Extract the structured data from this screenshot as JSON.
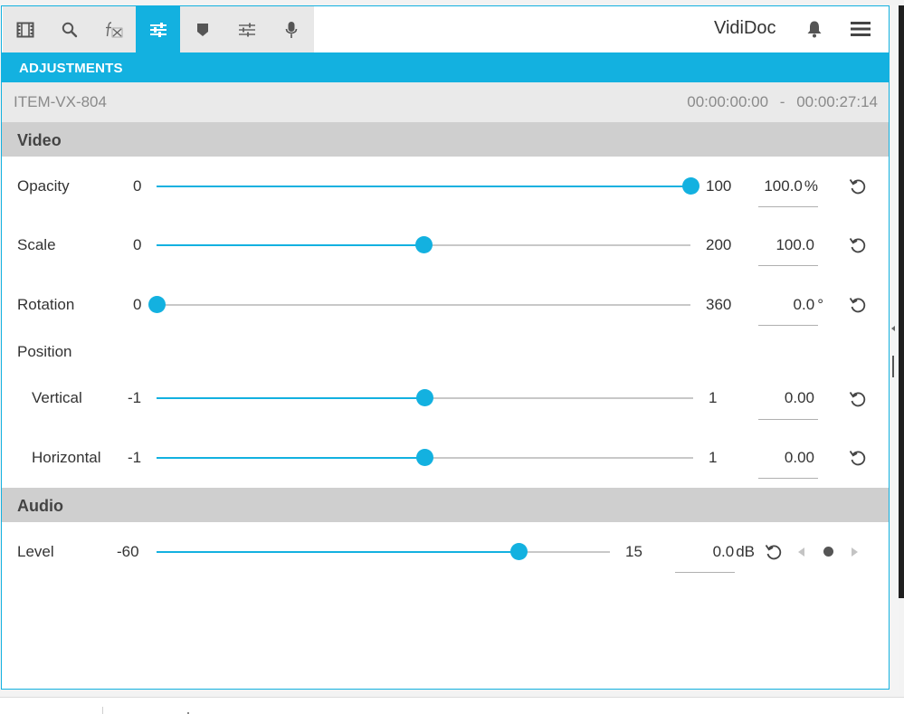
{
  "toolbar": {
    "tools": [
      {
        "icon": "film-strip-icon",
        "active": false
      },
      {
        "icon": "search-icon",
        "active": false
      },
      {
        "icon": "fx-icon",
        "active": false
      },
      {
        "icon": "sliders-icon",
        "active": true
      },
      {
        "icon": "marker-icon",
        "active": false
      },
      {
        "icon": "mixer-icon",
        "active": false
      },
      {
        "icon": "microphone-icon",
        "active": false
      }
    ],
    "brand": "VidiDoc",
    "bell_icon": "bell-icon",
    "menu_icon": "hamburger-menu-icon"
  },
  "panel": {
    "title": "ADJUSTMENTS",
    "item_id": "ITEM-VX-804",
    "timecode_start": "00:00:00:00",
    "timecode_separator": "-",
    "timecode_end": "00:00:27:14"
  },
  "video": {
    "header": "Video",
    "opacity": {
      "label": "Opacity",
      "min": "0",
      "max": "100",
      "value": "100.0",
      "unit": "%",
      "fraction": 1.0
    },
    "scale": {
      "label": "Scale",
      "min": "0",
      "max": "200",
      "value": "100.0",
      "unit": "",
      "fraction": 0.5
    },
    "rotation": {
      "label": "Rotation",
      "min": "0",
      "max": "360",
      "value": "0.0",
      "unit": "°",
      "fraction": 0.0
    },
    "position_label": "Position",
    "vertical": {
      "label": "Vertical",
      "min": "-1",
      "max": "1",
      "value": "0.00",
      "fraction": 0.5
    },
    "horizontal": {
      "label": "Horizontal",
      "min": "-1",
      "max": "1",
      "value": "0.00",
      "fraction": 0.5
    }
  },
  "audio": {
    "header": "Audio",
    "level": {
      "label": "Level",
      "min": "-60",
      "max": "15",
      "value": "0.0",
      "unit": "dB",
      "fraction": 0.8
    }
  },
  "colors": {
    "accent": "#13b1e0",
    "track": "#c8c8c8"
  }
}
